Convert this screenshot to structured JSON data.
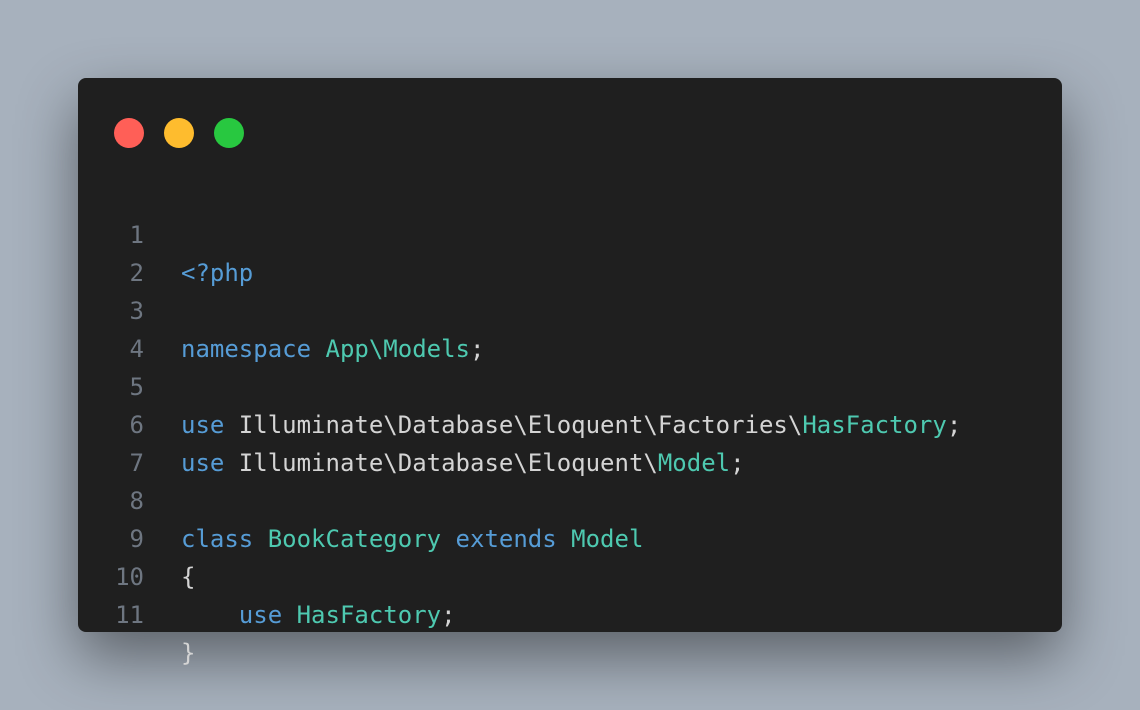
{
  "window": {
    "buttons": [
      {
        "name": "close",
        "color": "#ff5f57"
      },
      {
        "name": "minimize",
        "color": "#febc2e"
      },
      {
        "name": "maximize",
        "color": "#28c840"
      }
    ]
  },
  "colors": {
    "keyword": "#569cd6",
    "type": "#4ec9b0",
    "plain": "#d4d4d4",
    "line_number": "#6e7681",
    "editor_background": "#1f1f1f",
    "page_background": "#a7b1bd"
  },
  "code": {
    "lines": [
      {
        "number": "1",
        "tokens": [
          {
            "text": "<?php",
            "kind": "kw"
          }
        ]
      },
      {
        "number": "2",
        "tokens": []
      },
      {
        "number": "3",
        "tokens": [
          {
            "text": "namespace",
            "kind": "kw"
          },
          {
            "text": " ",
            "kind": "pl"
          },
          {
            "text": "App\\Models",
            "kind": "ty"
          },
          {
            "text": ";",
            "kind": "pl"
          }
        ]
      },
      {
        "number": "4",
        "tokens": []
      },
      {
        "number": "5",
        "tokens": [
          {
            "text": "use",
            "kind": "kw"
          },
          {
            "text": " Illuminate\\Database\\Eloquent\\Factories\\",
            "kind": "pl"
          },
          {
            "text": "HasFactory",
            "kind": "ty"
          },
          {
            "text": ";",
            "kind": "pl"
          }
        ]
      },
      {
        "number": "6",
        "tokens": [
          {
            "text": "use",
            "kind": "kw"
          },
          {
            "text": " Illuminate\\Database\\Eloquent\\",
            "kind": "pl"
          },
          {
            "text": "Model",
            "kind": "ty"
          },
          {
            "text": ";",
            "kind": "pl"
          }
        ]
      },
      {
        "number": "7",
        "tokens": []
      },
      {
        "number": "8",
        "tokens": [
          {
            "text": "class",
            "kind": "kw"
          },
          {
            "text": " ",
            "kind": "pl"
          },
          {
            "text": "BookCategory",
            "kind": "ty"
          },
          {
            "text": " ",
            "kind": "pl"
          },
          {
            "text": "extends",
            "kind": "kw"
          },
          {
            "text": " ",
            "kind": "pl"
          },
          {
            "text": "Model",
            "kind": "ty"
          }
        ]
      },
      {
        "number": "9",
        "tokens": [
          {
            "text": "{",
            "kind": "pl"
          }
        ]
      },
      {
        "number": "10",
        "tokens": [
          {
            "text": "    ",
            "kind": "pl"
          },
          {
            "text": "use",
            "kind": "kw"
          },
          {
            "text": " ",
            "kind": "pl"
          },
          {
            "text": "HasFactory",
            "kind": "ty"
          },
          {
            "text": ";",
            "kind": "pl"
          }
        ]
      },
      {
        "number": "11",
        "tokens": [
          {
            "text": "}",
            "kind": "pl"
          }
        ]
      }
    ]
  }
}
